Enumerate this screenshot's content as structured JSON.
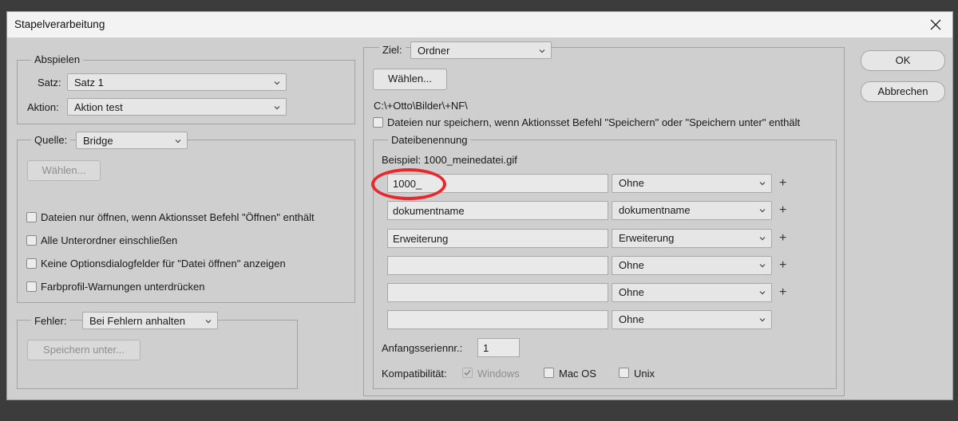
{
  "window": {
    "title": "Stapelverarbeitung"
  },
  "buttons": {
    "ok": "OK",
    "cancel": "Abbrechen"
  },
  "playback": {
    "legend": "Abspielen",
    "set_label": "Satz:",
    "set_value": "Satz 1",
    "action_label": "Aktion:",
    "action_value": "Aktion test"
  },
  "source": {
    "legend": "Quelle:",
    "value": "Bridge",
    "choose_button": "Wählen...",
    "checkboxes": [
      {
        "label": "Dateien nur öffnen, wenn Aktionsset Befehl \"Öffnen\" enthält",
        "checked": false
      },
      {
        "label": "Alle Unterordner einschließen",
        "checked": false
      },
      {
        "label": "Keine Optionsdialogfelder für \"Datei öffnen\" anzeigen",
        "checked": false
      },
      {
        "label": "Farbprofil-Warnungen unterdrücken",
        "checked": false
      }
    ]
  },
  "errors": {
    "legend": "Fehler:",
    "value": "Bei Fehlern anhalten",
    "save_button": "Speichern unter..."
  },
  "destination": {
    "legend": "Ziel:",
    "value": "Ordner",
    "choose_button": "Wählen...",
    "path": "C:\\+Otto\\Bilder\\+NF\\",
    "save_only_label": "Dateien nur speichern, wenn Aktionsset Befehl \"Speichern\" oder \"Speichern unter\" enthält",
    "save_only_checked": false
  },
  "naming": {
    "legend": "Dateibenennung",
    "example": "Beispiel: 1000_meinedatei.gif",
    "rows": [
      {
        "text": "1000_",
        "select": "Ohne",
        "plus": "+"
      },
      {
        "text": "dokumentname",
        "select": "dokumentname",
        "plus": "+"
      },
      {
        "text": "Erweiterung",
        "select": "Erweiterung",
        "plus": "+"
      },
      {
        "text": "",
        "select": "Ohne",
        "plus": "+"
      },
      {
        "text": "",
        "select": "Ohne",
        "plus": "+"
      },
      {
        "text": "",
        "select": "Ohne",
        "plus": ""
      }
    ],
    "serial_label": "Anfangsseriennr.:",
    "serial_value": "1",
    "compat_label": "Kompatibilität:",
    "compat": [
      {
        "label": "Windows",
        "checked": true,
        "disabled": true
      },
      {
        "label": "Mac OS",
        "checked": false,
        "disabled": false
      },
      {
        "label": "Unix",
        "checked": false,
        "disabled": false
      }
    ]
  },
  "annotation": {
    "color": "#e8282d"
  }
}
